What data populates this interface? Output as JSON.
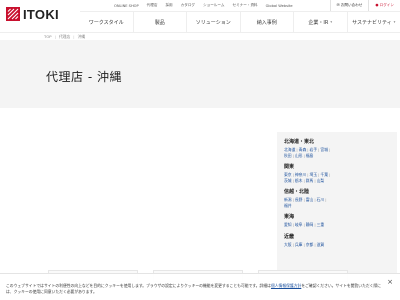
{
  "logo": {
    "text": "ITOKI",
    "icon": "itoki-logo-mark"
  },
  "util_bar": {
    "items": [
      "ONLINE SHOP",
      "代理店",
      "採用",
      "カタログ",
      "ショールーム",
      "セミナー・資料",
      "Global Website"
    ],
    "contact": "お問い合わせ",
    "login": "ログイン"
  },
  "main_nav": {
    "items": [
      "ワークスタイル",
      "製品",
      "ソリューション",
      "納入事例",
      "企業・IR",
      "サステナビリティ"
    ]
  },
  "breadcrumb": [
    "TOP",
    "代理店",
    "沖縄"
  ],
  "page_title": "代理店 - 沖縄",
  "regions": [
    {
      "title": "北海道・東北",
      "links": [
        "北海道",
        "青森",
        "岩手",
        "宮城",
        "秋田",
        "山形",
        "福島"
      ]
    },
    {
      "title": "関東",
      "links": [
        "東京",
        "神奈川",
        "埼玉",
        "千葉",
        "茨城",
        "栃木",
        "群馬",
        "山梨"
      ]
    },
    {
      "title": "信越・北陸",
      "links": [
        "新潟",
        "長野",
        "富山",
        "石川",
        "福井"
      ]
    },
    {
      "title": "東海",
      "links": [
        "愛知",
        "岐阜",
        "静岡",
        "三重"
      ]
    },
    {
      "title": "近畿",
      "links": [
        "大阪",
        "兵庫",
        "京都",
        "滋賀"
      ]
    }
  ],
  "cookie": {
    "text_before": "このウェブサイトではサイトの利便性の向上などを目的にクッキーを使用します。ブラウザの設定によりクッキーの機能を変更することも可能です。詳細は",
    "link": "個人情報保護方針",
    "text_after": "をご確認ください。サイトを閲覧いただく際には、クッキーの使用に同意いただく必要があります。",
    "close_icon": "close-icon"
  },
  "colors": {
    "accent_red": "#c8102e",
    "link_blue": "#1a4f9c",
    "band_gray": "#f4f4f4"
  }
}
